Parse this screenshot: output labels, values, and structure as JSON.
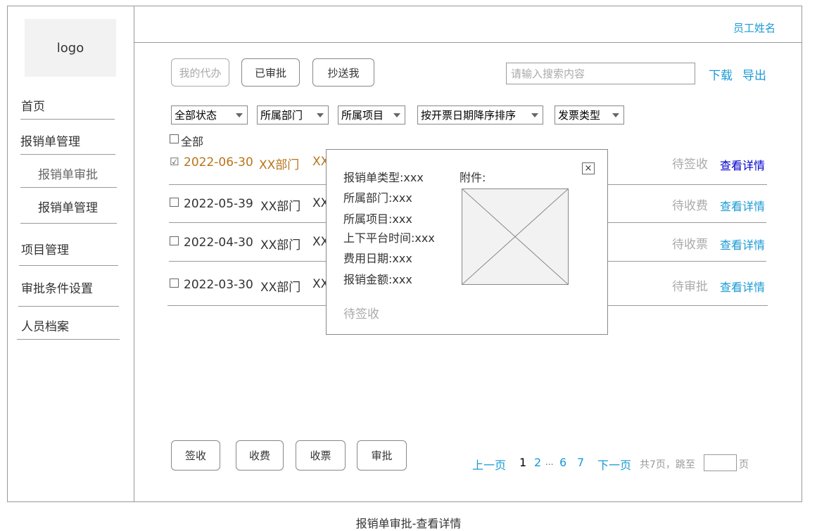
{
  "user": {
    "name": "员工姓名"
  },
  "logo": {
    "text": "logo"
  },
  "sidebar": {
    "items": [
      {
        "label": "首页"
      },
      {
        "label": "报销单管理"
      },
      {
        "label": "报销单审批"
      },
      {
        "label": "报销单管理"
      },
      {
        "label": "项目管理"
      },
      {
        "label": "审批条件设置"
      },
      {
        "label": "人员档案"
      }
    ]
  },
  "tabs": [
    {
      "label": "我的代办"
    },
    {
      "label": "已审批"
    },
    {
      "label": "抄送我"
    }
  ],
  "search": {
    "placeholder": "请输入搜索内容"
  },
  "actions": {
    "download": "下载",
    "export": "导出"
  },
  "filters": [
    {
      "label": "全部状态"
    },
    {
      "label": "所属部门"
    },
    {
      "label": "所属项目"
    },
    {
      "label": "按开票日期降序排序"
    },
    {
      "label": "发票类型"
    }
  ],
  "select_all": {
    "label": "全部"
  },
  "rows": [
    {
      "date": "2022-06-30",
      "dept": "XX部门",
      "proj": "XX",
      "status": "待签收",
      "action": "查看详情",
      "checked": true
    },
    {
      "date": "2022-05-39",
      "dept": "XX部门",
      "proj": "XX",
      "status": "待收费",
      "action": "查看详情",
      "checked": false
    },
    {
      "date": "2022-04-30",
      "dept": "XX部门",
      "proj": "XX",
      "status": "待收票",
      "action": "查看详情",
      "checked": false
    },
    {
      "date": "2022-03-30",
      "dept": "XX部门",
      "proj": "XX",
      "status": "待审批",
      "action": "查看详情",
      "checked": false
    }
  ],
  "modal": {
    "close": "×",
    "fields": [
      "报销单类型:xxx",
      "所属部门:xxx",
      "所属项目:xxx",
      "上下平台时间:xxx",
      "费用日期:xxx",
      "报销金额:xxx"
    ],
    "attachment_label": "附件:",
    "status": "待签收"
  },
  "bottom_buttons": [
    {
      "label": "签收"
    },
    {
      "label": "收费"
    },
    {
      "label": "收票"
    },
    {
      "label": "审批"
    }
  ],
  "pagination": {
    "prev": "上一页",
    "pages": [
      "1",
      "2",
      "...",
      "6",
      "7"
    ],
    "next": "下一页",
    "total": "共7页，跳至",
    "page_suffix": "页"
  },
  "caption": "报销单审批-查看详情",
  "colors": {
    "link": "#1a9ad6",
    "selected_row": "#b8741a",
    "detail_active": "#0000cc"
  }
}
